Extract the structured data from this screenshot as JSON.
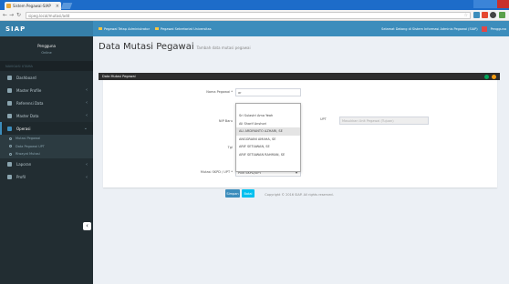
{
  "browser": {
    "tab_title": "Sistem Pegawai-SIAP",
    "url": "sipeg.local/mutasi/add",
    "icons": [
      "back-icon",
      "forward-icon",
      "reload-icon",
      "star-icon"
    ]
  },
  "app": {
    "logo": "SIAP",
    "nav": [
      {
        "label": "Pegawai Tetap Administrator"
      },
      {
        "label": "Pegawai Sekretariat Universitas"
      }
    ],
    "nav_right": "Selamat Datang di Sistem Informasi Adminis Pegawai (SIAP)",
    "nav_user": "Pengguna"
  },
  "sidebar": {
    "user_name": "Pengguna",
    "user_status": "Online",
    "header": "NAVIGASI UTAMA",
    "items": [
      {
        "label": "Dashboard",
        "icon": "dashboard-icon",
        "expandable": false
      },
      {
        "label": "Master Profile",
        "icon": "user-icon",
        "expandable": true
      },
      {
        "label": "Referensi Data",
        "icon": "database-icon",
        "expandable": true
      },
      {
        "label": "Master Data",
        "icon": "table-icon",
        "expandable": true
      },
      {
        "label": "Operasi",
        "icon": "exchange-icon",
        "expandable": true,
        "active": true
      }
    ],
    "subitems": [
      {
        "label": "Mutasi Pegawai"
      },
      {
        "label": "Data Pegawai UPT"
      },
      {
        "label": "Riwayat Mutasi"
      }
    ],
    "items2": [
      {
        "label": "Laporan",
        "icon": "report-icon",
        "expandable": true
      },
      {
        "label": "Profil",
        "icon": "profile-icon",
        "expandable": true
      }
    ]
  },
  "page": {
    "title": "Data Mutasi Pegawai",
    "subtitle": "Tambah data mutasi pegawai"
  },
  "form": {
    "box_title": "Data Mutasi Pegawai",
    "nama_label": "Nama Pegawai *",
    "nama_value": "ar",
    "nip_label": "NIP Baru",
    "nip_value": "",
    "upt_label": "UPT",
    "upt_value": "",
    "upt_placeholder": "Masukkan Unit Pegawai (Tujuan)",
    "tgl_label": "Tgl",
    "tgl_value": "",
    "mutasi_label": "Mutasi SKPD / UPT *",
    "mutasi_value": "Pilih SKPD/UPT",
    "options": [
      "Sri Sulastri Ama Yeah",
      "Ali Sharif Anshori",
      "ALI ARDIYANTO AZHARI, SE",
      "ANGGRAINI AMAHA, SE",
      "ARIF SETIAWAN, SE",
      "ARIF SETIAWAN RAHMAN, SE"
    ],
    "highlight_index": 2,
    "save_label": "Simpan",
    "back_label": "Batal"
  },
  "footer": "Copyright © 2016 SIAP. All rights reserved."
}
